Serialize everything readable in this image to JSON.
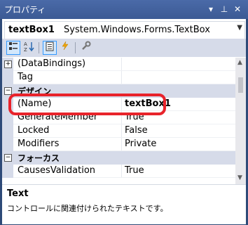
{
  "window": {
    "title": "プロパティ"
  },
  "object": {
    "name": "textBox1",
    "type": "System.Windows.Forms.TextBox"
  },
  "toolbar": [
    {
      "icon": "categorized-icon",
      "active": true
    },
    {
      "icon": "alphabetical-icon",
      "active": false
    },
    {
      "icon": "properties-icon",
      "active": true
    },
    {
      "icon": "events-icon",
      "active": false
    },
    {
      "icon": "property-pages-icon",
      "active": false
    }
  ],
  "grid": {
    "rows": [
      {
        "type": "prop",
        "name": "(DataBindings)",
        "value": "",
        "expander": "+"
      },
      {
        "type": "prop",
        "name": "Tag",
        "value": ""
      },
      {
        "type": "category",
        "name": "デザイン",
        "expander": "−"
      },
      {
        "type": "prop",
        "name": "(Name)",
        "value": "textBox1",
        "bold": true
      },
      {
        "type": "prop",
        "name": "GenerateMember",
        "value": "True"
      },
      {
        "type": "prop",
        "name": "Locked",
        "value": "False"
      },
      {
        "type": "prop",
        "name": "Modifiers",
        "value": "Private"
      },
      {
        "type": "category",
        "name": "フォーカス",
        "expander": "−"
      },
      {
        "type": "prop",
        "name": "CausesValidation",
        "value": "True"
      }
    ]
  },
  "description": {
    "title": "Text",
    "text": "コントロールに関連付けられたテキストです。"
  },
  "colors": {
    "titlebar": "#3c5a94",
    "highlight": "#e8232b",
    "category": "#d6dbe9"
  }
}
